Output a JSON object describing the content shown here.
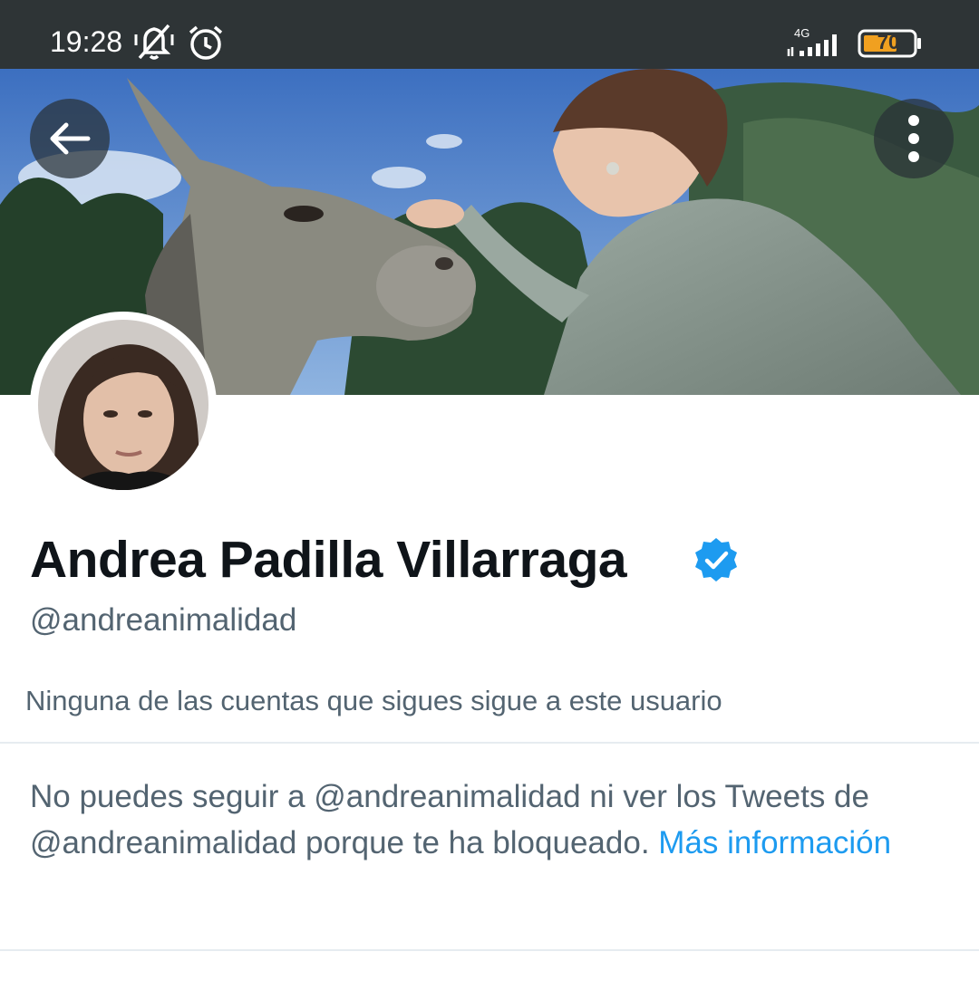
{
  "status_bar": {
    "time": "19:28",
    "network": "4G",
    "battery": "70",
    "icons": [
      "mute-icon",
      "alarm-icon",
      "signal-icon",
      "battery-icon"
    ]
  },
  "header": {
    "back_icon": "arrow-left-icon",
    "more_icon": "vertical-dots-icon"
  },
  "profile": {
    "display_name": "Andrea Padilla Villarraga",
    "verified_icon": "verified-badge-icon",
    "handle": "@andreanimalidad",
    "followers_note": "Ninguna de las cuentas que sigues sigue a este usuario"
  },
  "blocked": {
    "message": "No puedes seguir a @andreanimalidad ni ver los Tweets de @andreanimalidad porque te ha bloqueado.",
    "link_text": "Más información"
  },
  "colors": {
    "status_bar_bg": "#2e3436",
    "link": "#1d9bf0",
    "verified": "#1d9bf0",
    "secondary_text": "#536471",
    "battery_fill": "#f0a020"
  }
}
